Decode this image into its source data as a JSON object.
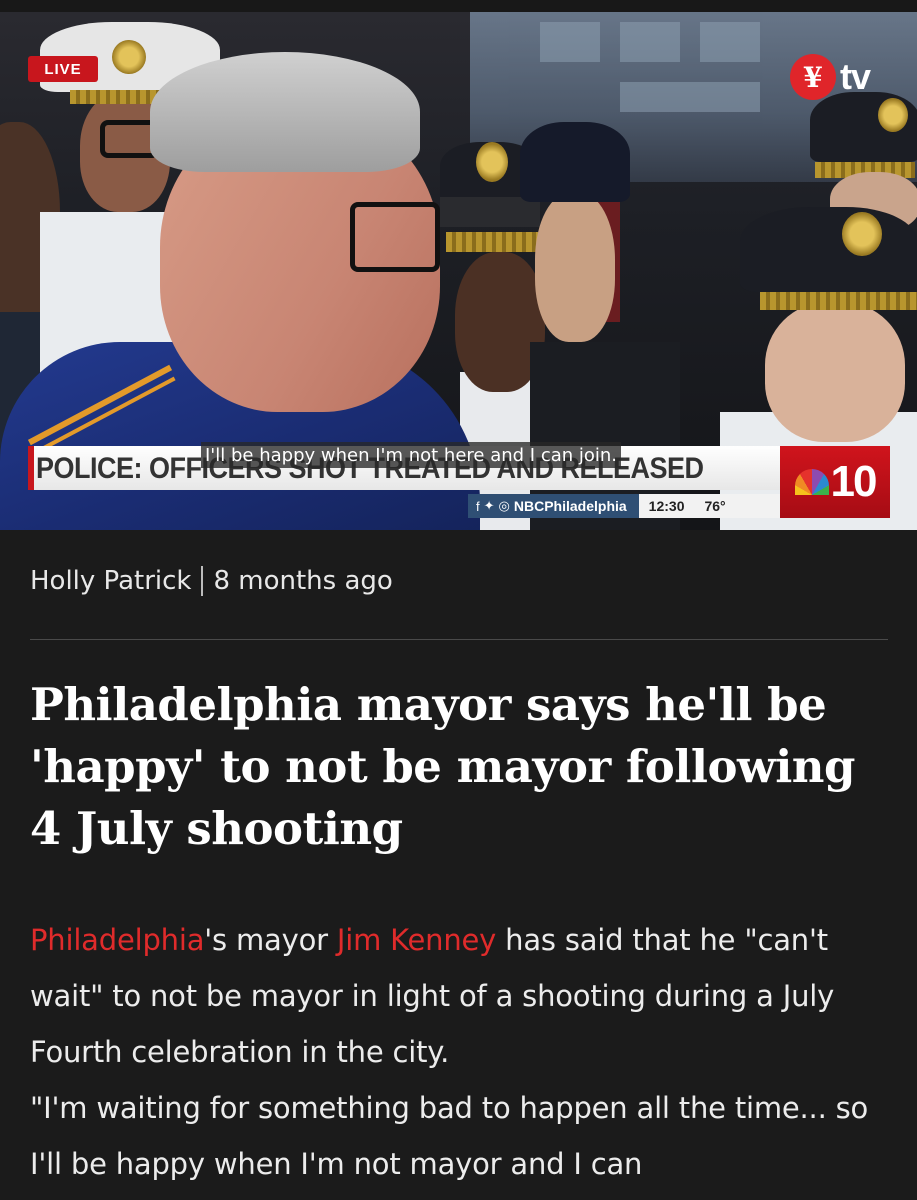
{
  "video": {
    "live_label": "LIVE",
    "channel_logo_text": "tv",
    "headline_chyron": "POLICE: OFFICERS SHOT TREATED AND RELEASED",
    "caption": "I'll be happy when I'm not here and I can join.",
    "station_number": "10",
    "social_handle": "NBCPhiladelphia",
    "social_icons": [
      "facebook-icon",
      "twitter-icon",
      "instagram-icon"
    ],
    "time": "12:30",
    "temperature": "76°"
  },
  "article": {
    "author": "Holly Patrick",
    "published": "8 months ago",
    "title": "Philadelphia mayor says he'll be 'happy' to not be mayor following 4 July shooting",
    "body": {
      "link_city": "Philadelphia",
      "text_1": "'s mayor ",
      "link_person": "Jim Kenney",
      "text_2": " has said that he \"can't wait\" to not be mayor in light of a shooting during a July Fourth celebration in the city.",
      "paragraph_2": "\"I'm waiting for something bad to happen all the time... so I'll be happy when I'm not mayor and I can"
    }
  },
  "colors": {
    "background": "#1b1b1b",
    "link": "#e02b2b",
    "live_red": "#c8161d"
  }
}
